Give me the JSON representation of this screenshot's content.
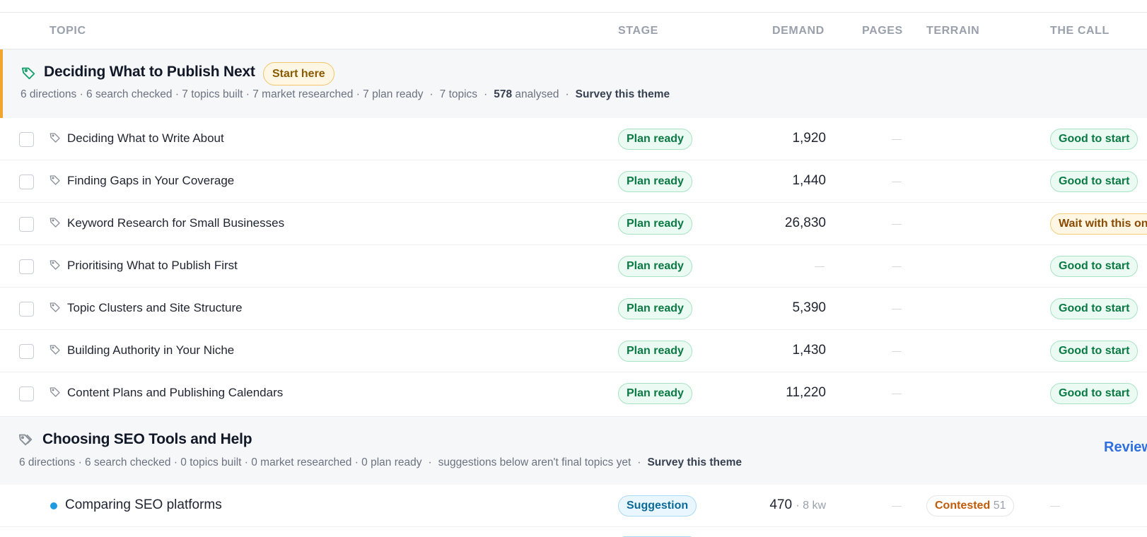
{
  "columns": {
    "topic": "TOPIC",
    "stage": "STAGE",
    "demand": "DEMAND",
    "pages": "PAGES",
    "terrain": "TERRAIN",
    "call": "THE CALL"
  },
  "theme1": {
    "title": "Deciding What to Publish Next",
    "badge": "Start here",
    "stats": "6 directions · 6 search checked · 7 topics built · 7 market researched · 7 plan ready",
    "topics_count": "7 topics",
    "analysed_num": "578",
    "analysed_label": "analysed",
    "survey_link": "Survey this theme",
    "icon": "tag-icon",
    "accent_color": "#f0a52c"
  },
  "theme1_rows": [
    {
      "title": "Deciding What to Write About",
      "stage": "Plan ready",
      "demand": "1,920",
      "call": "Good to start"
    },
    {
      "title": "Finding Gaps in Your Coverage",
      "stage": "Plan ready",
      "demand": "1,440",
      "call": "Good to start"
    },
    {
      "title": "Keyword Research for Small Businesses",
      "stage": "Plan ready",
      "demand": "26,830",
      "call": "Wait with this on"
    },
    {
      "title": "Prioritising What to Publish First",
      "stage": "Plan ready",
      "demand": "",
      "call": "Good to start"
    },
    {
      "title": "Topic Clusters and Site Structure",
      "stage": "Plan ready",
      "demand": "5,390",
      "call": "Good to start"
    },
    {
      "title": "Building Authority in Your Niche",
      "stage": "Plan ready",
      "demand": "1,430",
      "call": "Good to start"
    },
    {
      "title": "Content Plans and Publishing Calendars",
      "stage": "Plan ready",
      "demand": "11,220",
      "call": "Good to start"
    }
  ],
  "theme2": {
    "title": "Choosing SEO Tools and Help",
    "stats": "6 directions · 6 search checked · 0 topics built · 0 market researched · 0 plan ready",
    "note": "suggestions below aren't final topics yet",
    "survey_link": "Survey this theme",
    "review_link": "Review",
    "icon": "tags-icon"
  },
  "theme2_rows": [
    {
      "title": "Comparing SEO platforms",
      "stage": "Suggestion",
      "demand": "470",
      "demand_kw": "· 8 kw",
      "terrain": "Contested",
      "terrain_count": "51"
    }
  ],
  "colors": {
    "green": "#0a7a44",
    "amber": "#8a4a00",
    "blue": "#0a6a9a",
    "link": "#2f6fe0",
    "contested": "#c25a07"
  }
}
